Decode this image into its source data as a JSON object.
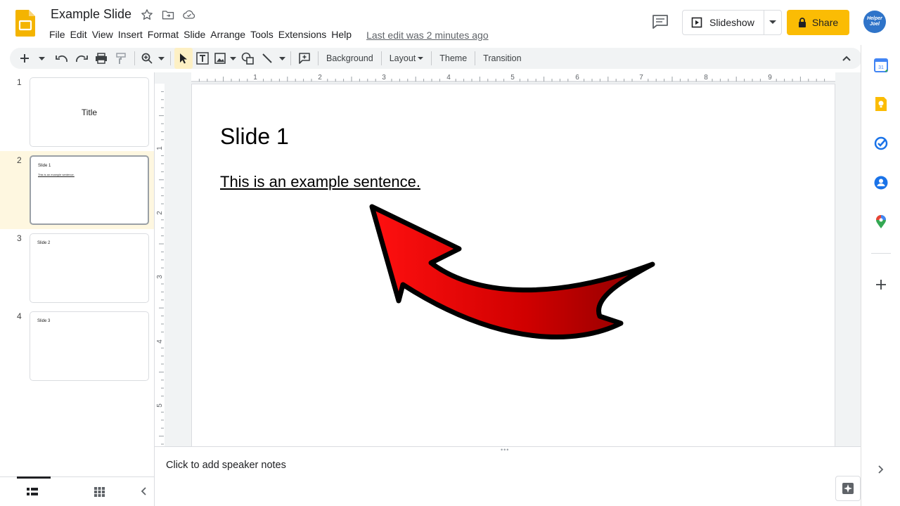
{
  "header": {
    "doc_title": "Example Slide",
    "menu": [
      "File",
      "Edit",
      "View",
      "Insert",
      "Format",
      "Slide",
      "Arrange",
      "Tools",
      "Extensions",
      "Help"
    ],
    "last_edit": "Last edit was 2 minutes ago",
    "slideshow_label": "Slideshow",
    "share_label": "Share",
    "avatar_text": "Helper Joel"
  },
  "toolbar": {
    "background_label": "Background",
    "layout_label": "Layout",
    "theme_label": "Theme",
    "transition_label": "Transition"
  },
  "filmstrip": {
    "slides": [
      {
        "number": "1",
        "center_text": "Title"
      },
      {
        "number": "2",
        "title": "Slide 1",
        "body": "This is an example sentence."
      },
      {
        "number": "3",
        "title": "Slide 2"
      },
      {
        "number": "4",
        "title": "Slide 3"
      }
    ],
    "selected_index": 1
  },
  "ruler": {
    "horizontal_labels": [
      "1",
      "2",
      "3",
      "4",
      "5",
      "6",
      "7",
      "8",
      "9"
    ],
    "vertical_labels": [
      "1",
      "2",
      "3",
      "4",
      "5"
    ]
  },
  "slide": {
    "title": "Slide 1",
    "body": "This is an example sentence.",
    "arrow_color": "#d40000"
  },
  "notes": {
    "placeholder": "Click to add speaker notes"
  },
  "side_panel": {
    "calendar_day": "31"
  },
  "colors": {
    "share_bg": "#fbbc04",
    "selected_row_bg": "#fef7e0",
    "avatar_bg": "#2f74c9"
  }
}
